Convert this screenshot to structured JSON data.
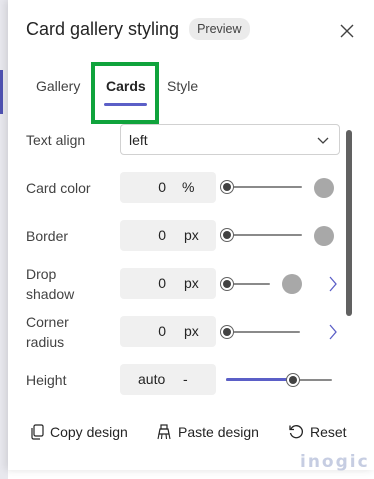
{
  "panel": {
    "title": "Card gallery styling",
    "badge": "Preview"
  },
  "tabs": [
    {
      "label": "Gallery",
      "active": false
    },
    {
      "label": "Cards",
      "active": true
    },
    {
      "label": "Style",
      "active": false
    }
  ],
  "fields": {
    "text_align": {
      "label": "Text align",
      "value": "left"
    },
    "card_color": {
      "label": "Card color",
      "value": "0",
      "unit": "%",
      "slider_level_percent": 0
    },
    "border": {
      "label": "Border",
      "value": "0",
      "unit": "px",
      "slider_level_percent": 0
    },
    "drop_shadow": {
      "label_line1": "Drop",
      "label_line2": "shadow",
      "value": "0",
      "unit": "px",
      "slider_level_percent": 0
    },
    "corner_radius": {
      "label_line1": "Corner",
      "label_line2": "radius",
      "value": "0",
      "unit": "px",
      "slider_level_percent": 0
    },
    "height": {
      "label": "Height",
      "value": "auto",
      "unit": "-",
      "slider_level_percent": 63
    }
  },
  "footer": {
    "copy": "Copy design",
    "paste": "Paste design",
    "reset": "Reset"
  },
  "watermark": "inogic",
  "colors": {
    "accent": "#5b5fc7",
    "highlight": "#10a33c",
    "swatch": "#a8a8a8"
  }
}
